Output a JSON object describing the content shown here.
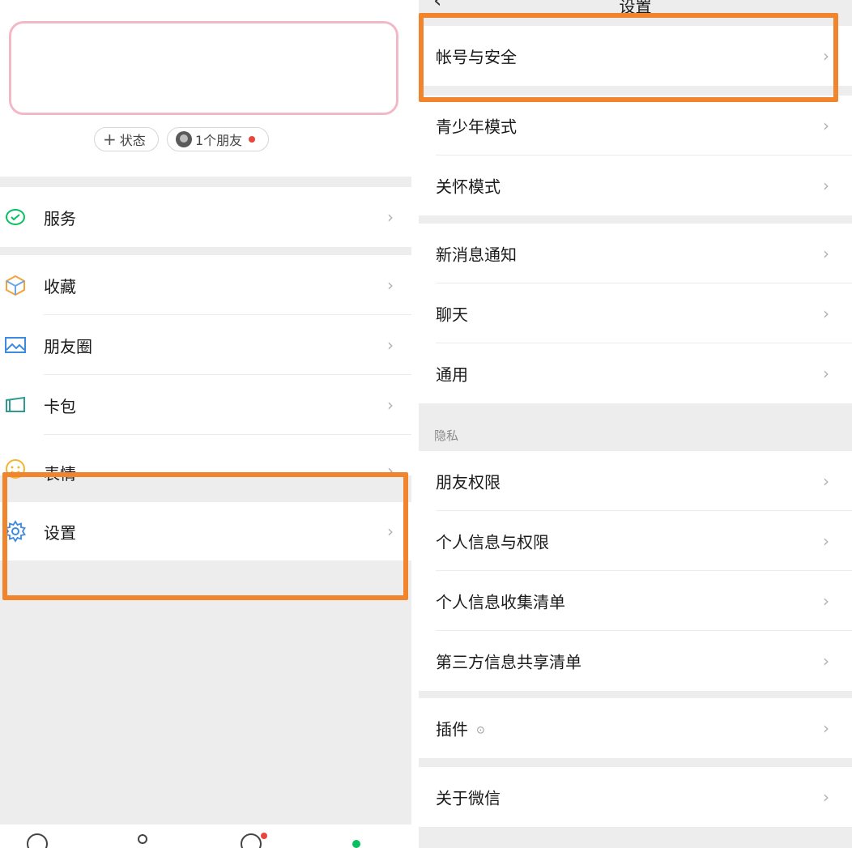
{
  "left": {
    "status_chip": {
      "plus": "+",
      "label": "状态"
    },
    "friends_chip": {
      "label": "1个朋友"
    },
    "menu": [
      {
        "label": "服务",
        "icon": "services-icon"
      },
      {
        "label": "收藏",
        "icon": "favorites-icon"
      },
      {
        "label": "朋友圈",
        "icon": "moments-icon"
      },
      {
        "label": "卡包",
        "icon": "cards-icon"
      },
      {
        "label": "表情",
        "icon": "sticker-icon"
      },
      {
        "label": "设置",
        "icon": "gear-icon"
      }
    ],
    "chevron": "›"
  },
  "right": {
    "header": {
      "back": "‹",
      "title": "设置"
    },
    "group1": [
      {
        "label": "帐号与安全"
      }
    ],
    "group2": [
      {
        "label": "青少年模式"
      },
      {
        "label": "关怀模式"
      }
    ],
    "group3": [
      {
        "label": "新消息通知"
      },
      {
        "label": "聊天"
      },
      {
        "label": "通用"
      }
    ],
    "privacy_section_label": "隐私",
    "group4": [
      {
        "label": "朋友权限"
      },
      {
        "label": "个人信息与权限"
      },
      {
        "label": "个人信息收集清单"
      },
      {
        "label": "第三方信息共享清单"
      }
    ],
    "group5": [
      {
        "label": "插件",
        "badge_icon": "⊙"
      }
    ],
    "group6": [
      {
        "label": "关于微信"
      }
    ],
    "chevron": "›"
  },
  "colors": {
    "highlight": "#f0852d",
    "accent_green": "#07c160",
    "badge_red": "#e8453c"
  }
}
